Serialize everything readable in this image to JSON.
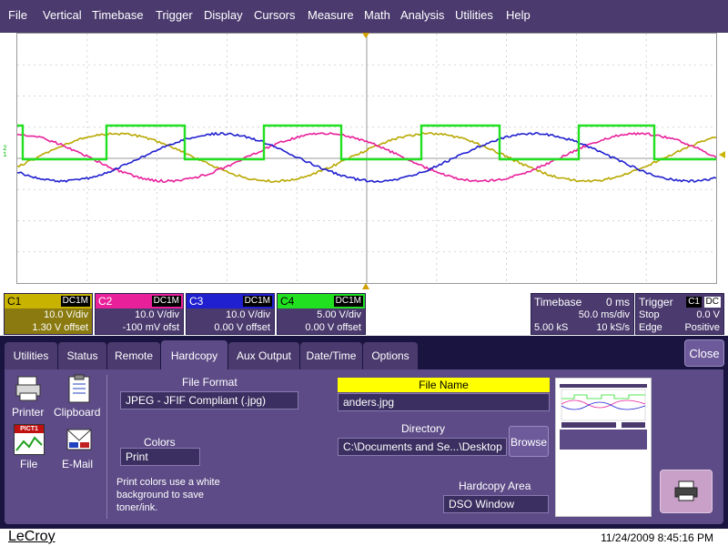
{
  "menu": [
    "File",
    "Vertical",
    "Timebase",
    "Trigger",
    "Display",
    "Cursors",
    "Measure",
    "Math",
    "Analysis",
    "Utilities",
    "Help"
  ],
  "colors": {
    "c1": "#c8b400",
    "c2": "#e8209a",
    "c3": "#2020d0",
    "c4": "#20e020",
    "trace1": "#b8a800"
  },
  "channels": [
    {
      "name": "C1",
      "coupling": "DC1M",
      "vdiv": "10.0 V/div",
      "offset": "1.30 V offset"
    },
    {
      "name": "C2",
      "coupling": "DC1M",
      "vdiv": "10.0 V/div",
      "offset": "-100 mV ofst"
    },
    {
      "name": "C3",
      "coupling": "DC1M",
      "vdiv": "10.0 V/div",
      "offset": "0.00 V offset"
    },
    {
      "name": "C4",
      "coupling": "DC1M",
      "vdiv": "5.00 V/div",
      "offset": "0.00 V offset"
    }
  ],
  "timebase": {
    "label": "Timebase",
    "delay": "0 ms",
    "tdiv": "50.0 ms/div",
    "samples": "5.00 kS",
    "rate": "10 kS/s"
  },
  "trigger": {
    "label": "Trigger",
    "chan": "C1",
    "coupling": "DC",
    "mode": "Stop",
    "level": "0.0 V",
    "type": "Edge",
    "slope": "Positive"
  },
  "tabs": [
    "Utilities",
    "Status",
    "Remote",
    "Hardcopy",
    "Aux Output",
    "Date/Time",
    "Options"
  ],
  "close_label": "Close",
  "hardcopy": {
    "printer": "Printer",
    "clipboard": "Clipboard",
    "file": "File",
    "email": "E-Mail",
    "pict_icon": "PICT1",
    "file_format_label": "File Format",
    "file_format": "JPEG - JFIF Compliant (.jpg)",
    "colors_label": "Colors",
    "colors_value": "Print",
    "colors_note_1": "Print colors use a white",
    "colors_note_2": "background to save",
    "colors_note_3": "toner/ink.",
    "file_name_label": "File Name",
    "file_name": "anders.jpg",
    "directory_label": "Directory",
    "directory": "C:\\Documents and Se...\\Desktop",
    "browse": "Browse",
    "area_label": "Hardcopy Area",
    "area_value": "DSO Window"
  },
  "brand": "LeCroy",
  "datetime": "11/24/2009 8:45:16 PM"
}
